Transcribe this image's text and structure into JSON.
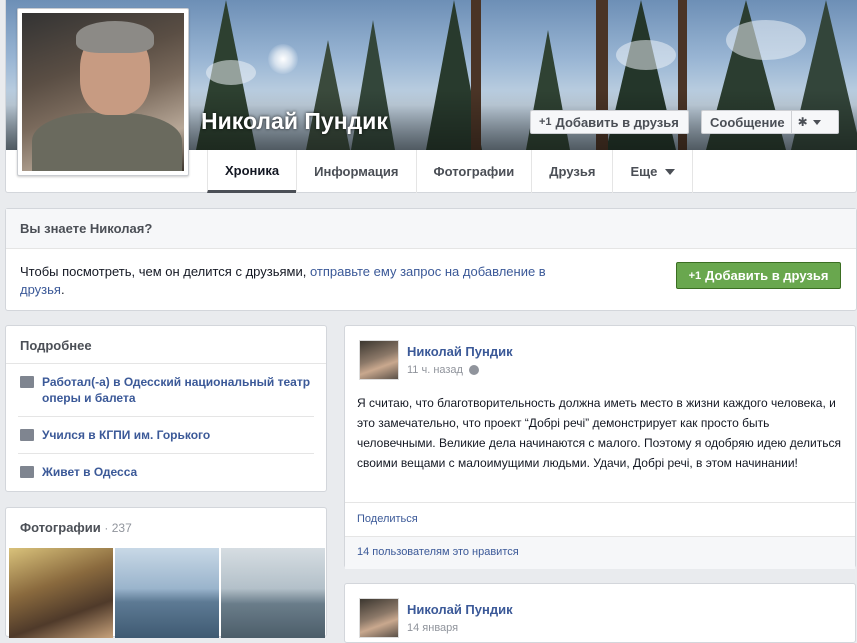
{
  "profile": {
    "name": "Николай Пундик"
  },
  "header_buttons": {
    "add_friend": "Добавить в друзья",
    "add_friend_plus": "+1",
    "message": "Сообщение",
    "gear_icon": "gear-icon"
  },
  "tabs": [
    {
      "label": "Хроника",
      "active": true
    },
    {
      "label": "Информация",
      "active": false
    },
    {
      "label": "Фотографии",
      "active": false
    },
    {
      "label": "Друзья",
      "active": false
    },
    {
      "label": "Еще",
      "active": false
    }
  ],
  "know": {
    "title": "Вы знаете Николая?",
    "text_plain": "Чтобы посмотреть, чем он делится с друзьями, ",
    "text_link": "отправьте ему запрос на добавление в друзья",
    "text_end": ".",
    "button_plus": "+1",
    "button": "Добавить в друзья",
    "button_color": "#69a74e"
  },
  "about": {
    "title": "Подробнее",
    "items": [
      {
        "icon": "briefcase-icon",
        "text": "Работал(-а) в Одесский национальный театр оперы и балета"
      },
      {
        "icon": "education-icon",
        "text": "Учился в КГПИ им. Горького"
      },
      {
        "icon": "home-icon",
        "text": "Живет в Одесса"
      }
    ]
  },
  "photos": {
    "title": "Фотографии",
    "count": "· 237"
  },
  "posts": [
    {
      "author": "Николай Пундик",
      "time": "11 ч. назад",
      "text": "Я считаю, что благотворительность должна иметь место в жизни каждого человека, и это замечательно, что проект “Добрі речі” демонстрирует как просто быть человечными. Великие дела начинаются с малого. Поэтому я одобряю идею делиться своими вещами с малоимущими людьми. Удачи, Добрі речі, в этом начинании!",
      "share": "Поделиться",
      "likes": "14 пользователям это нравится"
    },
    {
      "author": "Николай Пундик",
      "time": "14 января"
    }
  ],
  "colors": {
    "link": "#3b5998",
    "background": "#e9ebee"
  }
}
